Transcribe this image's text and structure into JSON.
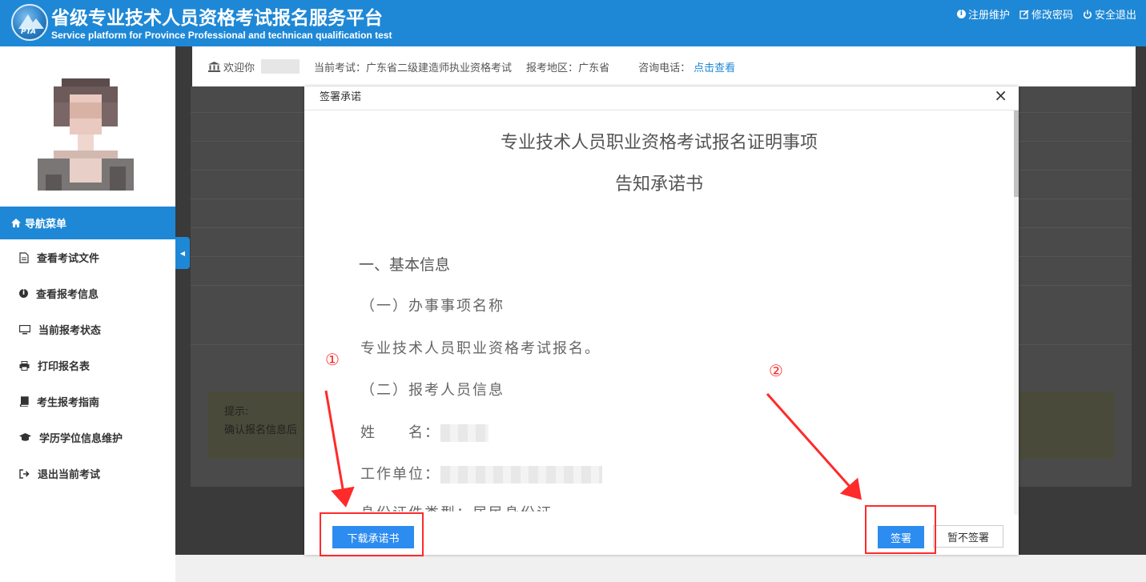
{
  "header": {
    "title_cn": "省级专业技术人员资格考试报名服务平台",
    "title_en": "Service platform for Province Professional and technican qualification test",
    "logo_text": "PTA",
    "links": [
      {
        "label": "注册维护",
        "icon": "info-icon"
      },
      {
        "label": "修改密码",
        "icon": "edit-icon"
      },
      {
        "label": "安全退出",
        "icon": "power-icon"
      }
    ]
  },
  "info_bar": {
    "welcome": "欢迎你",
    "current_exam_label": "当前考试：",
    "current_exam": "广东省二级建造师执业资格考试",
    "region_label": "报考地区：",
    "region": "广东省",
    "phone_label": "咨询电话：",
    "phone_link": "点击查看"
  },
  "sidebar": {
    "nav_header": "导航菜单",
    "items": [
      {
        "label": "查看考试文件",
        "icon": "file-icon"
      },
      {
        "label": "查看报考信息",
        "icon": "info-icon"
      },
      {
        "label": "当前报考状态",
        "icon": "monitor-icon"
      },
      {
        "label": "打印报名表",
        "icon": "print-icon"
      },
      {
        "label": "考生报考指南",
        "icon": "book-icon"
      },
      {
        "label": "学历学位信息维护",
        "icon": "graduation-cap-icon"
      },
      {
        "label": "退出当前考试",
        "icon": "sign-out-icon"
      }
    ]
  },
  "tip": {
    "title": "提示:",
    "text": "确认报名信息后"
  },
  "modal": {
    "title": "签署承诺",
    "close": "×",
    "doc_title_1": "专业技术人员职业资格考试报名证明事项",
    "doc_title_2": "告知承诺书",
    "section_1": "一、基本信息",
    "sub_1": "（一）办事事项名称",
    "sub_1_text": "专业技术人员职业资格考试报名。",
    "sub_2": "（二）报考人员信息",
    "name_label": "姓　　名：",
    "work_label": "工作单位：",
    "id_type_partial": "身份证件类型：居民身份证",
    "btn_download": "下载承诺书",
    "btn_sign": "签署",
    "btn_skip": "暂不签署"
  },
  "annotations": {
    "num_1": "①",
    "num_2": "②",
    "color": "#ff2a2a"
  },
  "colors": {
    "primary": "#1e88d6",
    "button": "#2d8cf0"
  }
}
